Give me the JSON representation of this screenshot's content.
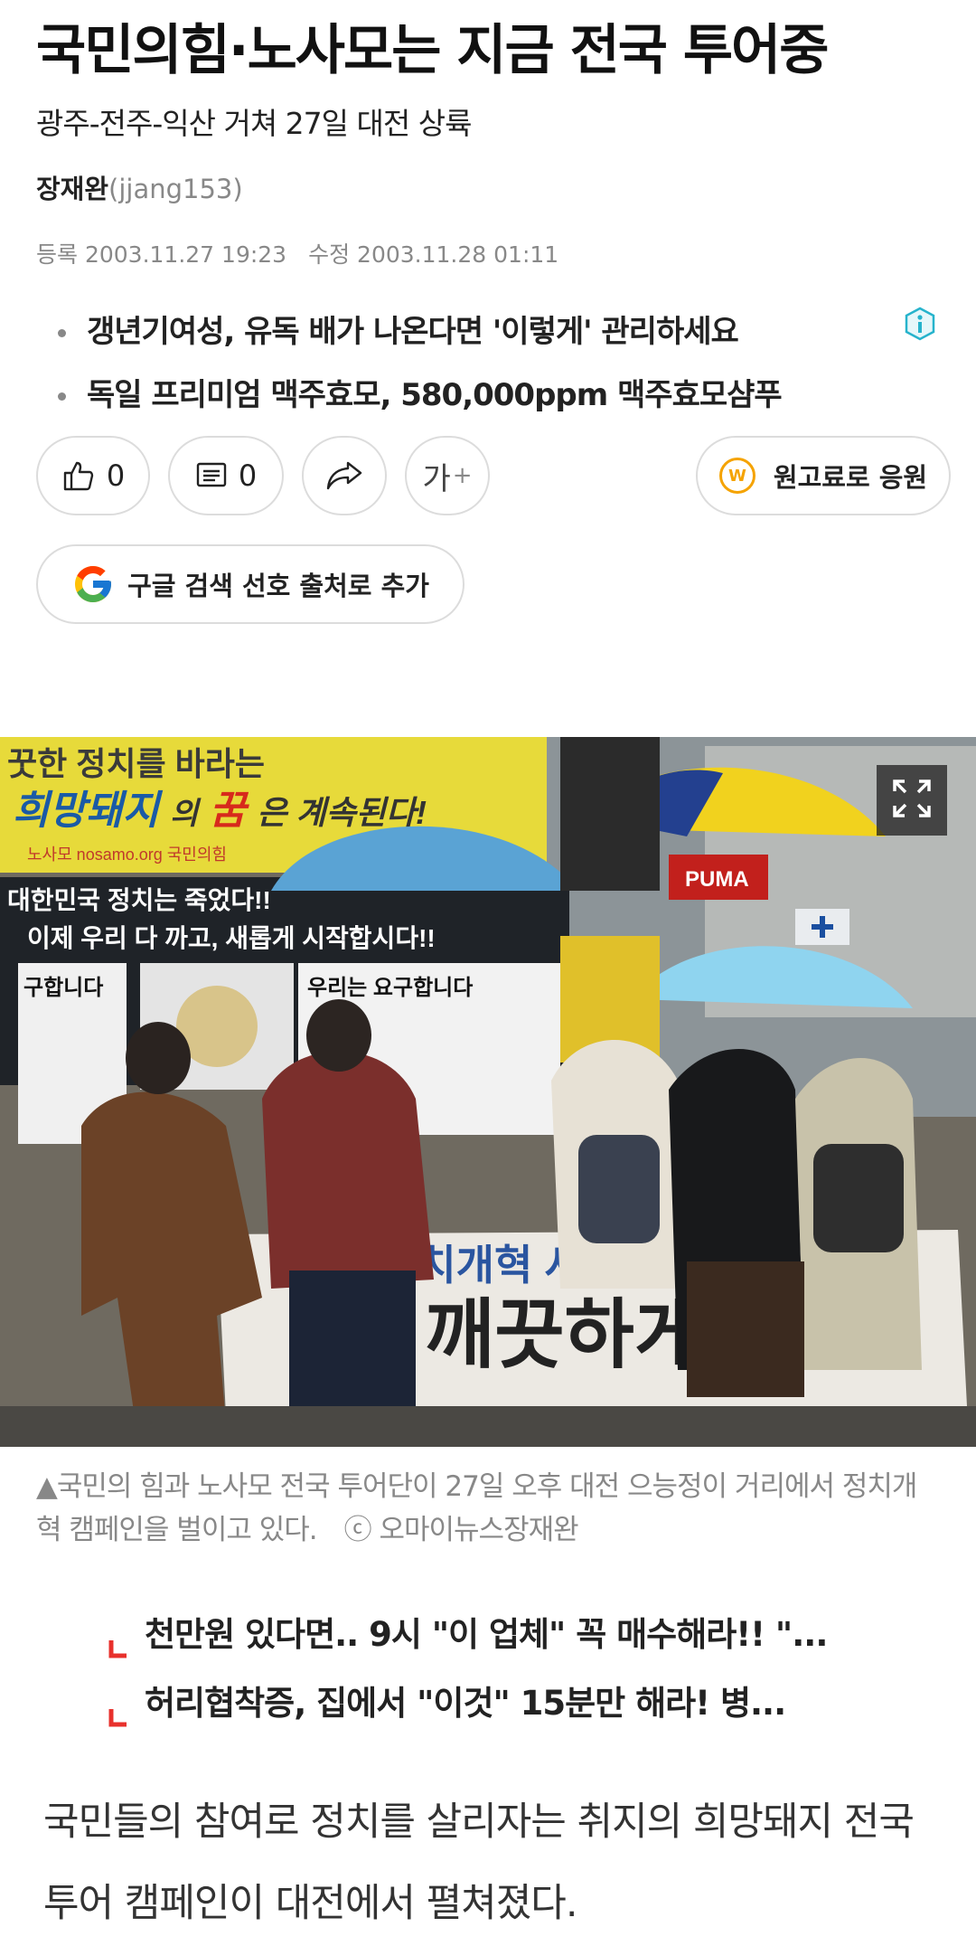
{
  "article": {
    "title": "국민의힘·노사모는 지금 전국 투어중",
    "subtitle": "광주-전주-익산 거쳐 27일 대전 상륙",
    "author": {
      "name": "장재완",
      "id": "(jjang153)"
    },
    "registered": "등록 2003.11.27 19:23",
    "modified": "수정 2003.11.28 01:11"
  },
  "ads": {
    "items": [
      "갱년기여성, 유독 배가 나온다면 '이렇게' 관리하세요",
      "독일 프리미엄 맥주효모, 580,000ppm 맥주효모샴푸"
    ],
    "info_icon": "info-icon"
  },
  "actions": {
    "like_count": "0",
    "comment_count": "0",
    "font_label": "가",
    "font_plus": "+",
    "support_label": "원고료로 응원",
    "support_symbol": "W",
    "google_label": "구글 검색 선호 출처로 추가"
  },
  "photo": {
    "caption": "▲국민의 힘과 노사모 전국 투어단이 27일 오후 대전 으능정이 거리에서 정치개혁 캠페인을 벌이고 있다.",
    "credit": "ⓒ 오마이뉴스장재완",
    "banner_text": {
      "line1": "꿋한 정치를 바라는",
      "line2a": "희망돼지",
      "line2b": "의",
      "line2c": "꿈",
      "line2d": "은 계속된다!",
      "line3": "노사모 nosamo.org   국민의힘"
    },
    "board_text": {
      "line1": "대한민국 정치는 죽었다!!",
      "line2": "이제 우리 다 까고, 새롭게 시작합시다!!",
      "left_box": "구합니다",
      "right_box": "우리는 요구합니다"
    },
    "store_sign": "PUMA",
    "table_banner": {
      "line1": "정치개혁 서명운동",
      "line2": "깨끗하게"
    }
  },
  "promo": {
    "items": [
      "천만원 있다면.. 9시 \"이 업체\" 꼭 매수해라!! \"...",
      "허리협착증, 집에서 \"이것\" 15분만 해라! 병..."
    ]
  },
  "body": {
    "paragraph": "국민들의 참여로 정치를 살리자는 취지의 희망돼지 전국투어 캠페인이 대전에서 펼쳐졌다."
  },
  "colors": {
    "accent_orange": "#f5a300",
    "promo_mark": "#e8312c",
    "caption_gray": "#888888"
  }
}
